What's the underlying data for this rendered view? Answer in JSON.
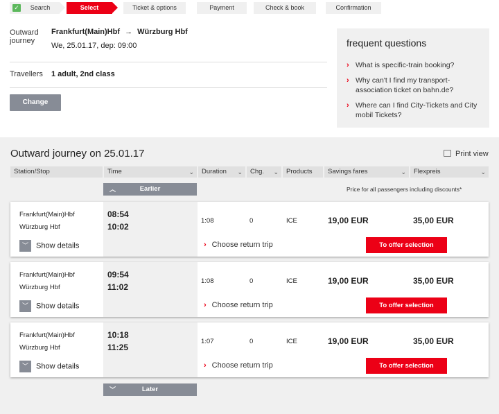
{
  "steps": [
    {
      "label": "Search",
      "state": "done"
    },
    {
      "label": "Select",
      "state": "active"
    },
    {
      "label": "Ticket & options",
      "state": "todo"
    },
    {
      "label": "Payment",
      "state": "todo"
    },
    {
      "label": "Check & book",
      "state": "todo"
    },
    {
      "label": "Confirmation",
      "state": "todo"
    }
  ],
  "summary": {
    "outward_label_1": "Outward",
    "outward_label_2": "journey",
    "route_from": "Frankfurt(Main)Hbf",
    "route_arrow": "→",
    "route_to": "Würzburg Hbf",
    "date_line": "We, 25.01.17, dep: 09:00",
    "travellers_label": "Travellers",
    "travellers_value": "1 adult, 2nd class",
    "change_label": "Change"
  },
  "faq": {
    "title": "frequent questions",
    "items": [
      "What is specific-train booking?",
      "Why can't I find my transport-association ticket on bahn.de?",
      "Where can I find City-Tickets and City mobil Tickets?"
    ]
  },
  "results": {
    "title": "Outward journey on 25.01.17",
    "print_label": "Print view",
    "columns": [
      "Station/Stop",
      "Time",
      "Duration",
      "Chg.",
      "Products",
      "Savings fares",
      "Flexpreis"
    ],
    "earlier_label": "Earlier",
    "later_label": "Later",
    "price_note": "Price for all passengers including discounts*",
    "show_details": "Show details",
    "choose_return": "Choose return trip",
    "offer_label": "To offer selection",
    "rows": [
      {
        "from": "Frankfurt(Main)Hbf",
        "to": "Würzburg Hbf",
        "dep": "08:54",
        "arr": "10:02",
        "duration": "1:08",
        "changes": "0",
        "product": "ICE",
        "savings": "19,00 EUR",
        "flex": "35,00 EUR"
      },
      {
        "from": "Frankfurt(Main)Hbf",
        "to": "Würzburg Hbf",
        "dep": "09:54",
        "arr": "11:02",
        "duration": "1:08",
        "changes": "0",
        "product": "ICE",
        "savings": "19,00 EUR",
        "flex": "35,00 EUR"
      },
      {
        "from": "Frankfurt(Main)Hbf",
        "to": "Würzburg Hbf",
        "dep": "10:18",
        "arr": "11:25",
        "duration": "1:07",
        "changes": "0",
        "product": "ICE",
        "savings": "19,00 EUR",
        "flex": "35,00 EUR"
      }
    ]
  },
  "colors": {
    "accent": "#ec0016",
    "button_gray": "#878c96",
    "background": "#f0f0f0"
  }
}
